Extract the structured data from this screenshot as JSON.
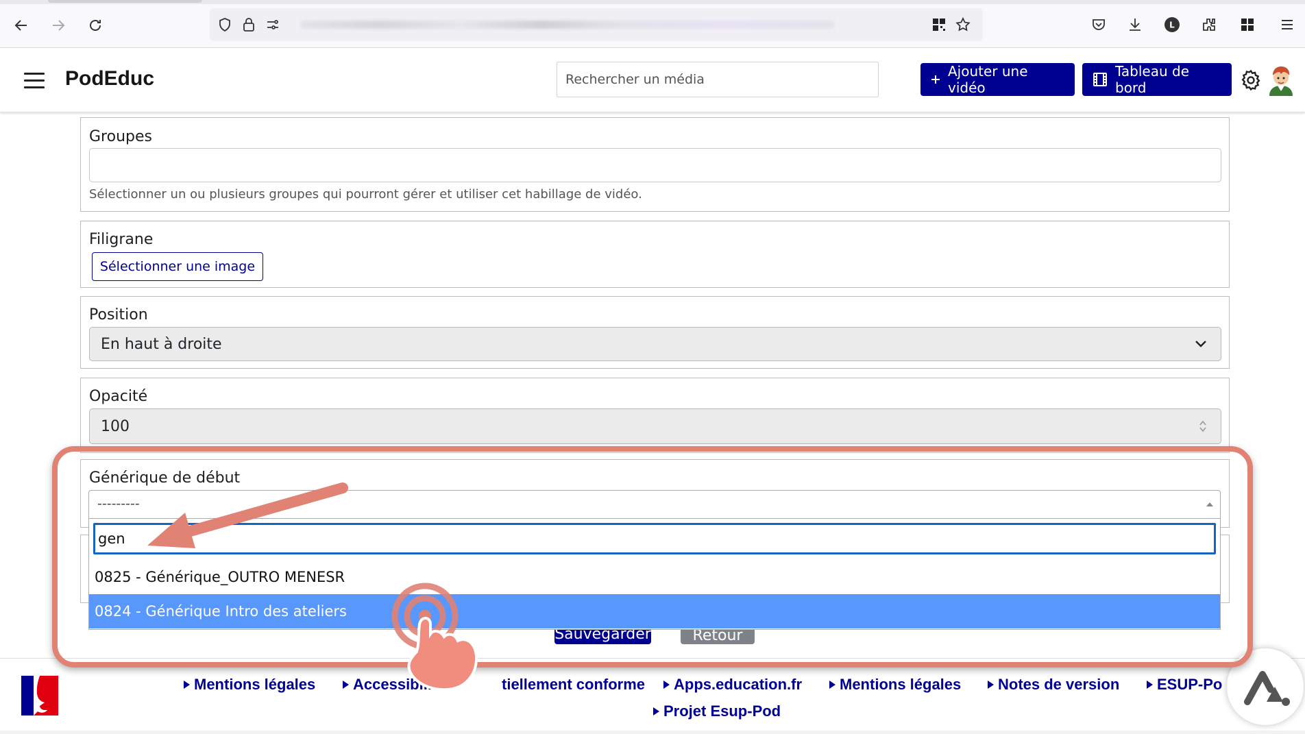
{
  "app": {
    "brand": "PodEduc",
    "search_placeholder": "Rechercher un média",
    "add_video_label": "Ajouter une vidéo",
    "dashboard_label": "Tableau de bord"
  },
  "form": {
    "groups": {
      "label": "Groupes",
      "value": "",
      "help": "Sélectionner un ou plusieurs groupes qui pourront gérer et utiliser cet habillage de vidéo."
    },
    "watermark": {
      "label": "Filigrane",
      "button_label": "Sélectionner une image"
    },
    "position": {
      "label": "Position",
      "selected": "En haut à droite"
    },
    "opacity": {
      "label": "Opacité",
      "value": "100"
    },
    "intro_credits": {
      "label": "Générique de début",
      "selected": "---------",
      "search_value": "gen",
      "options": [
        {
          "label": "0825 - Générique_OUTRO MENESR",
          "highlighted": false
        },
        {
          "label": "0824 - Générique Intro des ateliers",
          "highlighted": true
        }
      ]
    },
    "save_label": "Sauvegarder",
    "back_label": "Retour"
  },
  "footer": {
    "links": [
      "Mentions légales",
      "Accessibilité : partiellement conforme",
      "Apps.education.fr",
      "Mentions légales",
      "Notes de version",
      "ESUP-Pod"
    ],
    "links_visible": [
      "Mentions légales",
      "Accessibilit",
      "tiellement conforme",
      "Apps.education.fr",
      "Mentions légales",
      "Notes de version",
      "ESUP-Po"
    ],
    "project_link": "Projet Esup-Pod"
  },
  "icons": {
    "back": "back-arrow-icon",
    "forward": "forward-arrow-icon",
    "reload": "reload-icon",
    "shield": "shield-icon",
    "lock": "lock-icon",
    "permissions": "permissions-icon",
    "qr": "qr-code-icon",
    "bookmark": "star-icon",
    "pocket": "pocket-icon",
    "download": "download-icon",
    "account": "account-icon",
    "extensions": "extensions-icon",
    "apps": "apps-icon",
    "menu": "menu-icon",
    "settings": "gear-icon"
  },
  "colors": {
    "primary": "#000091",
    "option_highlight": "#5897fb",
    "annotation": "#e08274",
    "focus_ring": "#1565c0"
  }
}
